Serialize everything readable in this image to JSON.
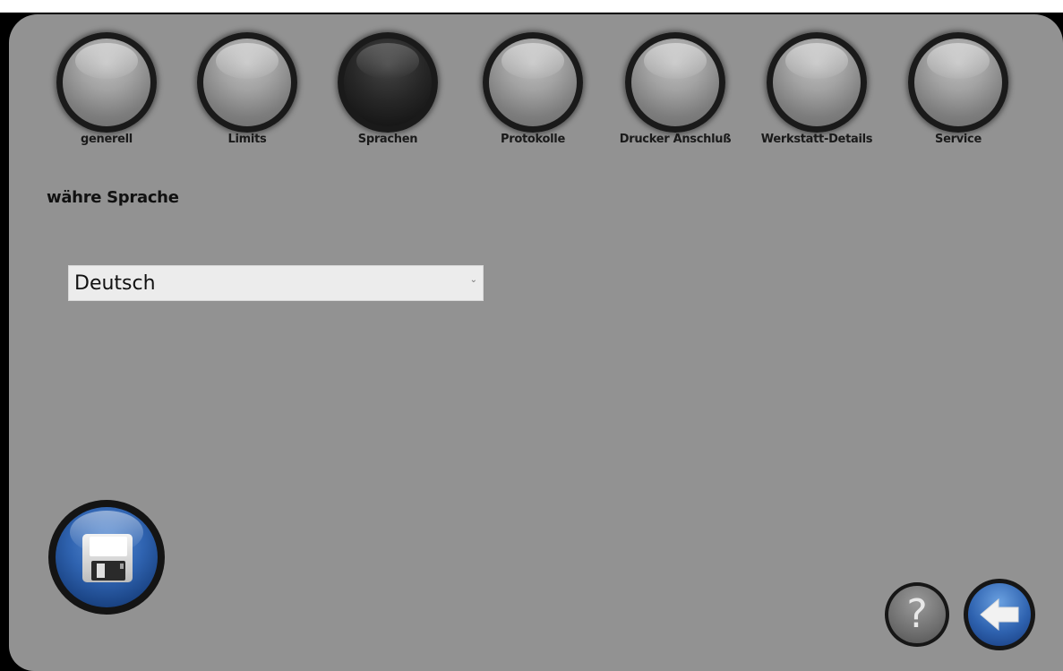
{
  "tabs": [
    {
      "label": "generell",
      "active": false
    },
    {
      "label": "Limits",
      "active": false
    },
    {
      "label": "Sprachen",
      "active": true
    },
    {
      "label": "Protokolle",
      "active": false
    },
    {
      "label": "Drucker Anschluß",
      "active": false
    },
    {
      "label": "Werkstatt-Details",
      "active": false
    },
    {
      "label": "Service",
      "active": false
    }
  ],
  "language_section": {
    "title": "währe Sprache",
    "selected_language": "Deutsch"
  },
  "buttons": {
    "save_icon": "floppy-disk-icon",
    "help_icon": "question-mark-icon",
    "help_glyph": "?",
    "back_icon": "arrow-left-icon"
  },
  "colors": {
    "panel": "#929292",
    "accent_blue": "#2f63b0"
  }
}
